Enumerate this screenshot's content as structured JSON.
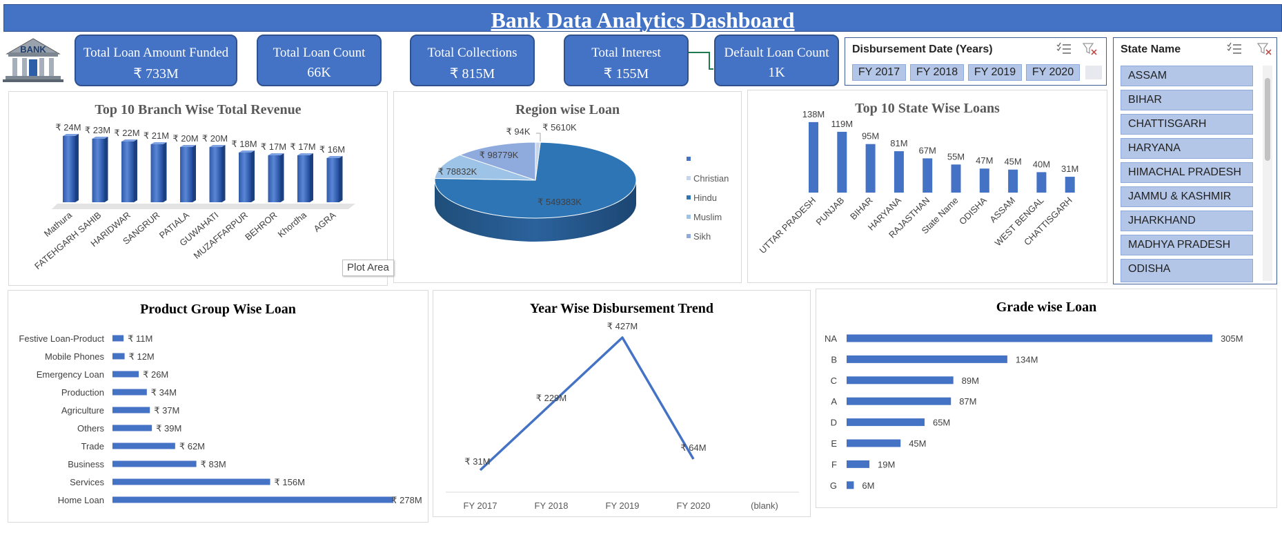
{
  "header": {
    "title": "Bank Data Analytics Dashboard",
    "logo_text": "BANK"
  },
  "kpis": [
    {
      "label": "Total Loan Amount Funded",
      "value": "₹ 733M"
    },
    {
      "label": "Total Loan Count",
      "value": "66K"
    },
    {
      "label": "Total Collections",
      "value": "₹ 815M"
    },
    {
      "label": "Total Interest",
      "value": "₹ 155M"
    },
    {
      "label": "Default Loan Count",
      "value": "1K"
    }
  ],
  "year_slicer": {
    "title": "Disbursement Date (Years)",
    "items": [
      "FY 2017",
      "FY 2018",
      "FY 2019",
      "FY 2020"
    ]
  },
  "state_slicer": {
    "title": "State Name",
    "items": [
      "ASSAM",
      "BIHAR",
      "CHATTISGARH",
      "HARYANA",
      "HIMACHAL PRADESH",
      "JAMMU & KASHMIR",
      "JHARKHAND",
      "MADHYA PRADESH",
      "ODISHA"
    ]
  },
  "tooltip": "Plot Area",
  "colors": {
    "primary": "#4472c4",
    "border": "#2f528f",
    "chip": "#b4c6e7"
  },
  "chart_data": [
    {
      "id": "branch",
      "type": "bar",
      "title": "Top 10 Branch Wise Total Revenue",
      "categories": [
        "Mathura",
        "FATEHGARH SAHIB",
        "HARIDWAR",
        "SANGRUR",
        "PATIALA",
        "GUWAHATI",
        "MUZAFFARPUR",
        "BEHROR",
        "Khordha",
        "AGRA"
      ],
      "values": [
        24,
        23,
        22,
        21,
        20,
        20,
        18,
        17,
        17,
        16
      ],
      "labels": [
        "₹ 24M",
        "₹ 23M",
        "₹ 22M",
        "₹ 21M",
        "₹ 20M",
        "₹ 20M",
        "₹ 18M",
        "₹ 17M",
        "₹ 17M",
        "₹ 16M"
      ]
    },
    {
      "id": "region",
      "type": "pie",
      "title": "Region wise Loan",
      "categories": [
        "",
        "Christian",
        "Hindu",
        "Muslim",
        "Sikh"
      ],
      "values": [
        94,
        5610,
        549383,
        78832,
        98779
      ],
      "labels": [
        "₹ 94K",
        "₹ 5610K",
        "₹ 549383K",
        "₹ 78832K",
        "₹ 98779K"
      ],
      "colors": [
        "#4472c4",
        "#c5d5ee",
        "#2e75b6",
        "#9dc3e6",
        "#8faadc"
      ]
    },
    {
      "id": "state",
      "type": "bar",
      "title": "Top 10 State Wise Loans",
      "categories": [
        "UTTAR PRADESH",
        "PUNJAB",
        "BIHAR",
        "HARYANA",
        "RAJASTHAN",
        "State Name",
        "ODISHA",
        "ASSAM",
        "WEST BENGAL",
        "CHATTISGARH"
      ],
      "values": [
        138,
        119,
        95,
        81,
        67,
        55,
        47,
        45,
        40,
        31
      ],
      "labels": [
        "138M",
        "119M",
        "95M",
        "81M",
        "67M",
        "55M",
        "47M",
        "45M",
        "40M",
        "31M"
      ]
    },
    {
      "id": "product",
      "type": "bar",
      "orientation": "horizontal",
      "title": "Product Group Wise Loan",
      "categories": [
        "Festive Loan-Product",
        "Mobile Phones",
        "Emergency Loan",
        "Production",
        "Agriculture",
        "Others",
        "Trade",
        "Business",
        "Services",
        "Home Loan"
      ],
      "values": [
        11,
        12,
        26,
        34,
        37,
        39,
        62,
        83,
        156,
        278
      ],
      "labels": [
        "₹ 11M",
        "₹ 12M",
        "₹ 26M",
        "₹ 34M",
        "₹ 37M",
        "₹ 39M",
        "₹ 62M",
        "₹ 83M",
        "₹ 156M",
        "₹ 278M"
      ]
    },
    {
      "id": "trend",
      "type": "line",
      "title": "Year Wise Disbursement Trend",
      "x": [
        "FY 2017",
        "FY 2018",
        "FY 2019",
        "FY 2020",
        "(blank)"
      ],
      "values": [
        31,
        229,
        427,
        64
      ],
      "labels": [
        "₹ 31M",
        "₹ 229M",
        "₹ 427M",
        "₹ 64M"
      ]
    },
    {
      "id": "grade",
      "type": "bar",
      "orientation": "horizontal",
      "title": "Grade wise Loan",
      "categories": [
        "NA",
        "B",
        "C",
        "A",
        "D",
        "E",
        "F",
        "G"
      ],
      "values": [
        305,
        134,
        89,
        87,
        65,
        45,
        19,
        6
      ],
      "labels": [
        "305M",
        "134M",
        "89M",
        "87M",
        "65M",
        "45M",
        "19M",
        "6M"
      ]
    }
  ]
}
